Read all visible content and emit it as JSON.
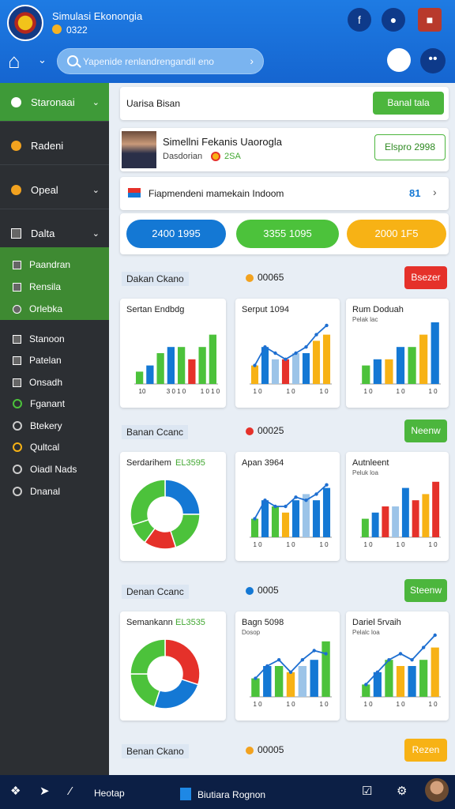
{
  "app": {
    "title": "Simulasi Ekonongia",
    "subtitle": "0322",
    "search_placeholder": "Yapenide renlandrengandil eno"
  },
  "sidebar": {
    "sections": [
      {
        "label": "Staronaai",
        "icon": "gear-icon",
        "color": "#3aa84a"
      },
      {
        "label": "Radeni",
        "icon": "orange-dot-icon",
        "color": "#f2a21f"
      },
      {
        "label": "Opeal",
        "icon": "orange-dot-icon",
        "color": "#f2a21f"
      },
      {
        "label": "Dalta",
        "icon": "chart-icon"
      }
    ],
    "subitems": [
      "Paandran",
      "Rensila",
      "Orlebka"
    ],
    "items": [
      "Stanoon",
      "Patelan",
      "Onsadh",
      "Fganant",
      "Btekery",
      "Qultcal",
      "Oiadl Nads",
      "Dnanal"
    ]
  },
  "header": {
    "title": "Uarisa Bisan",
    "button": "Banal tala"
  },
  "profile": {
    "name": "Simellni Fekanis Uaorogla",
    "role": "Dasdorian",
    "badge": "2SA",
    "button": "Elspro 2998"
  },
  "notice": {
    "text": "Fiapmendeni mamekain Indoom",
    "count": "81"
  },
  "stats": [
    {
      "label": "2400 1995",
      "color": "#1478d4"
    },
    {
      "label": "3355 1095",
      "color": "#4cc23b"
    },
    {
      "label": "2000 1F5",
      "color": "#f7b215"
    }
  ],
  "sections": [
    {
      "title": "Dakan Ckano",
      "count": "00065",
      "dot": "#f2a21f",
      "button": "Bsezer",
      "btn_color": "#e5312a"
    },
    {
      "title": "Banan Ccanc",
      "count": "00025",
      "dot": "#e5312a",
      "button": "Neenw",
      "btn_color": "#4cb63d"
    },
    {
      "title": "Denan Ccanc",
      "count": "0005",
      "dot": "#1478d4",
      "button": "Steenw",
      "btn_color": "#4cb63d"
    },
    {
      "title": "Benan Ckano",
      "count": "00005",
      "dot": "#f2a21f",
      "button": "Rezen",
      "btn_color": "#f7b215"
    }
  ],
  "chart_cards": [
    {
      "title": "Sertan Endbdg",
      "subtitle": "",
      "footer": [
        "10",
        "3 0 1 0",
        "1 0 1 0"
      ]
    },
    {
      "title": "Serput 1094",
      "subtitle": "",
      "footer": [
        "1 0",
        "1 0",
        "1 0"
      ]
    },
    {
      "title": "Rum Doduah",
      "subtitle": "Pelak lac",
      "footer": [
        "1 0",
        "1 0",
        "1 0"
      ]
    },
    {
      "title": "Serdarihem",
      "subtitle": "",
      "green": "EL3595"
    },
    {
      "title": "Apan 3964",
      "subtitle": "",
      "footer": [
        "1 0",
        "1 0",
        "1 0"
      ]
    },
    {
      "title": "Autnleent",
      "subtitle": "Peluk loa",
      "footer": [
        "1 0",
        "1 0",
        "1 0"
      ]
    },
    {
      "title": "Semankann",
      "subtitle": "",
      "green": "EL3535"
    },
    {
      "title": "Bagn 5098",
      "subtitle": "Dosop",
      "footer": [
        "1 0",
        "1 0",
        "1 0"
      ]
    },
    {
      "title": "Dariel 5rvaih",
      "subtitle": "Pelalc loa",
      "footer": [
        "1 0",
        "1 0",
        "1 0"
      ]
    }
  ],
  "chart_data": [
    {
      "type": "bar",
      "series": [
        {
          "values": [
            2,
            3,
            5,
            6,
            6,
            4,
            6,
            8
          ]
        }
      ],
      "colors": [
        "#4cc23b",
        "#1478d4",
        "#4cc23b",
        "#1478d4",
        "#4cc23b",
        "#e5312a",
        "#4cc23b",
        "#4cc23b"
      ],
      "line": [],
      "ylim": [
        0,
        10
      ]
    },
    {
      "type": "bar",
      "series": [
        {
          "values": [
            3,
            6,
            4,
            4,
            5,
            5,
            7,
            8
          ]
        }
      ],
      "colors": [
        "#f7b215",
        "#1478d4",
        "#9cc4e8",
        "#e5312a",
        "#9cc4e8",
        "#1478d4",
        "#f7b215",
        "#f7b215"
      ],
      "line": [
        3,
        6,
        5,
        4,
        5,
        6,
        8,
        9.5
      ],
      "ylim": [
        0,
        10
      ]
    },
    {
      "type": "bar",
      "series": [
        {
          "values": [
            3,
            4,
            4,
            6,
            6,
            8,
            10
          ]
        }
      ],
      "colors": [
        "#4cc23b",
        "#1478d4",
        "#f7b215",
        "#1478d4",
        "#4cc23b",
        "#f7b215",
        "#1478d4"
      ],
      "line": [],
      "ylim": [
        0,
        10
      ]
    },
    {
      "type": "pie",
      "values": [
        25,
        20,
        15,
        10,
        30
      ],
      "colors": [
        "#1478d4",
        "#4cc23b",
        "#e5312a",
        "#4cc23b",
        "#4cc23b"
      ]
    },
    {
      "type": "bar",
      "series": [
        {
          "values": [
            3,
            6,
            5,
            4,
            6,
            7,
            6,
            8
          ]
        }
      ],
      "colors": [
        "#4cc23b",
        "#1478d4",
        "#4cc23b",
        "#f7b215",
        "#1478d4",
        "#9cc4e8",
        "#1478d4",
        "#1478d4"
      ],
      "line": [
        3,
        6,
        5,
        5,
        6.5,
        6,
        7,
        8.5
      ],
      "ylim": [
        0,
        10
      ]
    },
    {
      "type": "bar",
      "series": [
        {
          "values": [
            3,
            4,
            5,
            5,
            8,
            6,
            7,
            9
          ]
        }
      ],
      "colors": [
        "#4cc23b",
        "#1478d4",
        "#e5312a",
        "#9cc4e8",
        "#1478d4",
        "#e5312a",
        "#f7b215",
        "#e5312a"
      ],
      "line": [],
      "ylim": [
        0,
        10
      ]
    },
    {
      "type": "pie",
      "values": [
        30,
        25,
        20,
        25
      ],
      "colors": [
        "#e5312a",
        "#1478d4",
        "#4cc23b",
        "#4cc23b"
      ]
    },
    {
      "type": "bar",
      "series": [
        {
          "values": [
            3,
            5,
            5,
            4,
            5,
            6,
            9
          ]
        }
      ],
      "colors": [
        "#4cc23b",
        "#1478d4",
        "#4cc23b",
        "#f7b215",
        "#9cc4e8",
        "#1478d4",
        "#4cc23b"
      ],
      "line": [
        3,
        5,
        6,
        4,
        6,
        7.5,
        7
      ],
      "ylim": [
        0,
        10
      ]
    },
    {
      "type": "bar",
      "series": [
        {
          "values": [
            2,
            4,
            6,
            5,
            5,
            6,
            8
          ]
        }
      ],
      "colors": [
        "#4cc23b",
        "#1478d4",
        "#4cc23b",
        "#f7b215",
        "#1478d4",
        "#4cc23b",
        "#f7b215"
      ],
      "line": [
        2,
        4,
        6,
        7,
        6,
        8,
        10
      ],
      "ylim": [
        0,
        10
      ]
    }
  ],
  "taskbar": {
    "label": "Heotap",
    "app": "Biutiara Rognon"
  }
}
